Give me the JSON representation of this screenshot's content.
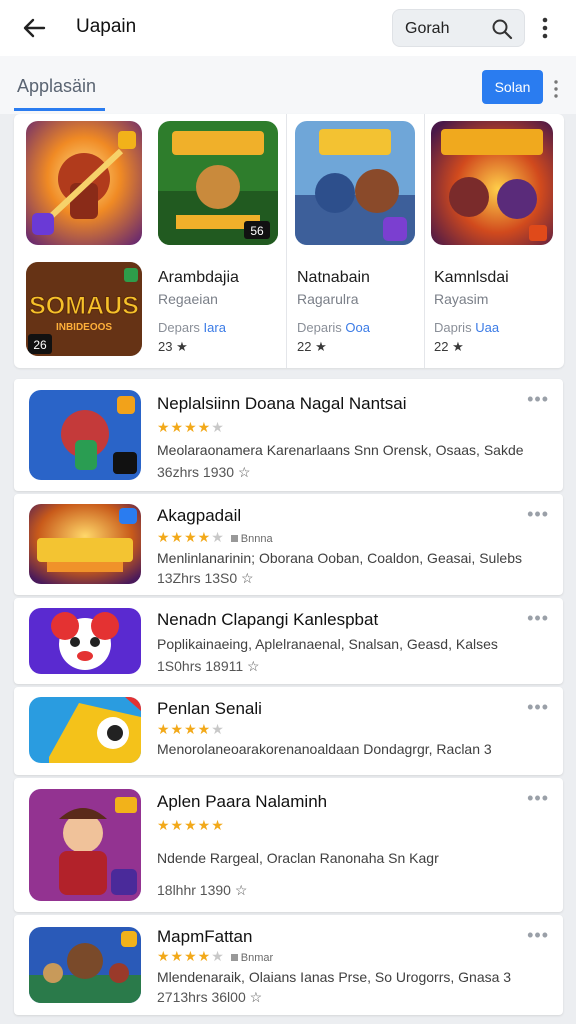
{
  "header": {
    "title": "Uapain",
    "search_placeholder": "Gorah"
  },
  "section": {
    "title": "Applasäin",
    "button_label": "Solan"
  },
  "featured": [
    {
      "name": "Arambdajia",
      "subtitle": "Regaeian",
      "dev_prefix": "Depars",
      "dev_link": "Iara",
      "rating": "23 ★",
      "badge": "56"
    },
    {
      "name": "Natnabain",
      "subtitle": "Ragarulra",
      "dev_prefix": "Deparis",
      "dev_link": "Ooa",
      "rating": "22 ★"
    },
    {
      "name": "Kamnlsdai",
      "subtitle": "Rayasim",
      "dev_prefix": "Dapris",
      "dev_link": "Uaa",
      "rating": "22 ★"
    }
  ],
  "featured_banner": {
    "line1": "SOMAUS",
    "line2": "INBIDEOOS",
    "badge": "26"
  },
  "apps": [
    {
      "name": "Neplalsiinn Doana Nagal Nantsai",
      "stars": "★★★★",
      "stars_empty": "★",
      "badge": "",
      "desc": "Meolaraonamera Karenarlaans Snn Orensk, Osaas, Sakde",
      "meta": "36zhrs   1930 ☆"
    },
    {
      "name": "Akagpadail",
      "stars": "★★★★",
      "stars_empty": "★",
      "badge": "Bnnna",
      "desc": "Menlinlanarinin; Oborana Ooban, Coaldon, Geasai, Sulebs",
      "meta": "13Zhrs   13S0 ☆"
    },
    {
      "name": "Nenadn Clapangi Kanlespbat",
      "stars": "",
      "stars_empty": "",
      "badge": "",
      "desc": "Poplikainaeing, Aplelranaenal, Snalsan, Geasd, Kalses",
      "meta": "1S0hrs   18911 ☆"
    },
    {
      "name": "Penlan Senali",
      "stars": "★★★★",
      "stars_empty": "★",
      "badge": "",
      "desc": "Menorolaneoarakorenanoaldaan Dondagrgr, Raclan 3",
      "meta": ""
    },
    {
      "name": "Aplen Paara Nalaminh",
      "stars": "★★★★★",
      "stars_empty": "",
      "badge": "",
      "desc": "Ndende Rargeal, Oraclan Ranonaha Sn Kagr",
      "meta": "18lhhr   1390 ☆"
    },
    {
      "name": "MapmFattan",
      "stars": "★★★★",
      "stars_empty": "★",
      "badge": "Bnmar",
      "desc": "Mlendenaraik, Olaians Ianas Prse, So Urogorrs, Gnasa 3",
      "meta": "2713hrs   36l00 ☆"
    }
  ],
  "colors": {
    "accent": "#2a7cf0",
    "star": "#f2a91a"
  },
  "icons": [
    "back-arrow-icon",
    "search-icon",
    "more-vert-icon",
    "more-horiz-icon"
  ]
}
